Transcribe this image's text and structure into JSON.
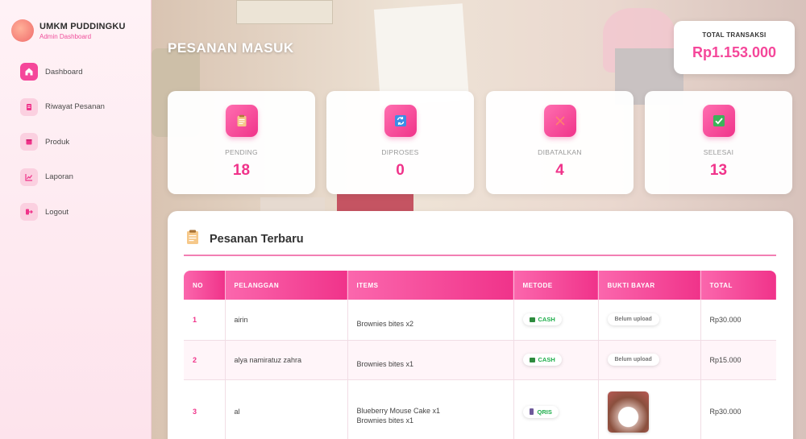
{
  "brand": {
    "title": "UMKM PUDDINGKU",
    "subtitle": "Admin Dashboard",
    "logo_text": "PUDDINGKU"
  },
  "sidebar": {
    "items": [
      {
        "label": "Dashboard",
        "icon": "home-icon",
        "active": true
      },
      {
        "label": "Riwayat Pesanan",
        "icon": "receipt-icon",
        "active": false
      },
      {
        "label": "Produk",
        "icon": "box-icon",
        "active": false
      },
      {
        "label": "Laporan",
        "icon": "chart-icon",
        "active": false
      },
      {
        "label": "Logout",
        "icon": "logout-icon",
        "active": false
      }
    ]
  },
  "header": {
    "title": "PESANAN MASUK"
  },
  "total": {
    "label": "TOTAL TRANSAKSI",
    "value": "Rp1.153.000"
  },
  "stats": [
    {
      "label": "PENDING",
      "value": "18",
      "icon": "clipboard-icon"
    },
    {
      "label": "DIPROSES",
      "value": "0",
      "icon": "refresh-icon"
    },
    {
      "label": "DIBATALKAN",
      "value": "4",
      "icon": "cross-icon"
    },
    {
      "label": "SELESAI",
      "value": "13",
      "icon": "check-icon"
    }
  ],
  "orders": {
    "title": "Pesanan Terbaru",
    "columns": [
      "NO",
      "PELANGGAN",
      "ITEMS",
      "METODE",
      "BUKTI BAYAR",
      "TOTAL"
    ],
    "rows": [
      {
        "no": "1",
        "customer": "airin",
        "items": [
          "Brownies bites x2"
        ],
        "method": "CASH",
        "proof": "Belum upload",
        "total": "Rp30.000"
      },
      {
        "no": "2",
        "customer": "alya namiratuz zahra",
        "items": [
          "Brownies bites x1"
        ],
        "method": "CASH",
        "proof": "Belum upload",
        "total": "Rp15.000"
      },
      {
        "no": "3",
        "customer": "al",
        "items": [
          "Blueberry Mouse Cake x1",
          "Brownies bites x1"
        ],
        "method": "QRIS",
        "proof": "image",
        "total": "Rp30.000"
      }
    ]
  },
  "colors": {
    "accent": "#f0338a",
    "accent_light": "#fb67ad",
    "sidebar_bg": "#fde8ef",
    "success": "#1fae4b"
  }
}
